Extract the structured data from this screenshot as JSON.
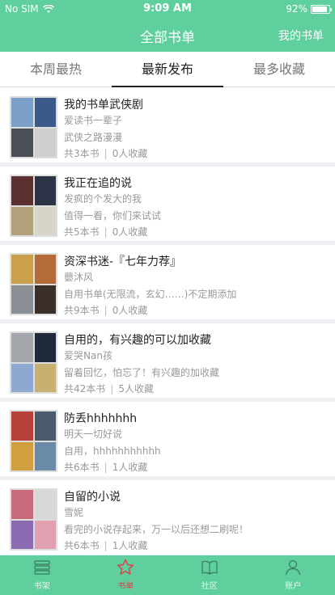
{
  "status": {
    "carrier": "No SIM",
    "time": "9:09 AM",
    "battery": "92%",
    "battery_level": 0.92
  },
  "nav": {
    "title": "全部书单",
    "right": "我的书单"
  },
  "tabs": [
    {
      "label": "本周最热",
      "active": false
    },
    {
      "label": "最新发布",
      "active": true
    },
    {
      "label": "最多收藏",
      "active": false
    }
  ],
  "items": [
    {
      "title": "我的书单武侠剧",
      "author": "爱读书一辈子",
      "desc": "武侠之路漫漫",
      "count": "共3本书",
      "favs": "0人收藏",
      "covers": [
        "#7aa0c8",
        "#3a5a8a",
        "#4a4f57",
        "#cfcfcf"
      ]
    },
    {
      "title": "我正在追的说",
      "author": "发疯的个发大的我",
      "desc": "值得一看，你们来试试",
      "count": "共5本书",
      "favs": "0人收藏",
      "covers": [
        "#5a3030",
        "#2c3346",
        "#b2a17a",
        "#d8d4c8"
      ]
    },
    {
      "title": "资深书迷-『七年力荐』",
      "author": "蘡沐风",
      "desc": "自用书单(无限流，玄幻……)不定期添加",
      "count": "共9本书",
      "favs": "0人收藏",
      "covers": [
        "#caa04a",
        "#b56a3a",
        "#8a8f95",
        "#3b2f2a"
      ]
    },
    {
      "title": "自用的，有兴趣的可以加收藏",
      "author": "爱哭Nan孩",
      "desc": "留着回忆，怕忘了！有兴趣的加收藏",
      "count": "共42本书",
      "favs": "5人收藏",
      "covers": [
        "#a4a8ad",
        "#1e2a3a",
        "#8fa8d0",
        "#c8b070"
      ]
    },
    {
      "title": "防丢hhhhhhh",
      "author": "明天一切好说",
      "desc": "自用，hhhhhhhhhhh",
      "count": "共6本书",
      "favs": "1人收藏",
      "covers": [
        "#b8403a",
        "#4a5a6a",
        "#d0a040",
        "#6a8aa8"
      ]
    },
    {
      "title": "自留的小说",
      "author": "雪妮",
      "desc": "看完的小说存起来，万一以后还想二刷呢！",
      "count": "共6本书",
      "favs": "1人收藏",
      "covers": [
        "#c86a7a",
        "#d8d8d8",
        "#8a6ab0",
        "#e0a0b0"
      ]
    }
  ],
  "tabbar": [
    {
      "label": "书架",
      "icon": "bookshelf-icon",
      "active": false
    },
    {
      "label": "书单",
      "icon": "star-icon",
      "active": true
    },
    {
      "label": "社区",
      "icon": "book-open-icon",
      "active": false
    },
    {
      "label": "账户",
      "icon": "user-icon",
      "active": false
    }
  ],
  "colors": {
    "accent": "#5fcf9e",
    "active_tab": "#d9444a"
  }
}
